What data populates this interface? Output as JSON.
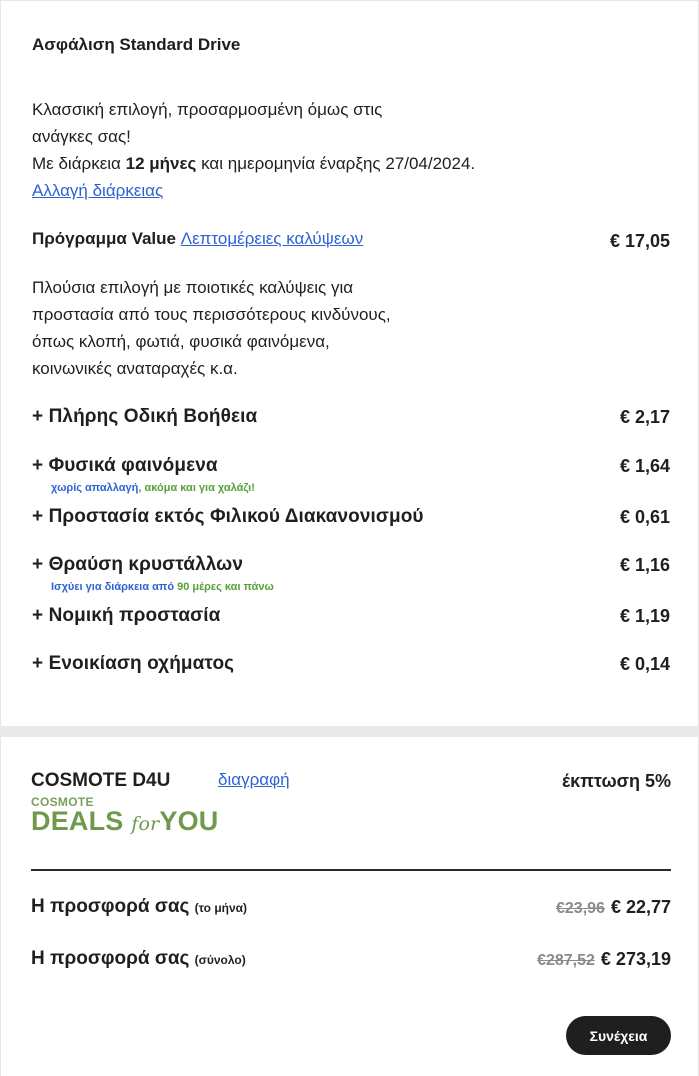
{
  "insurance": {
    "title": "Ασφάλιση Standard Drive",
    "intro_line1": "Κλασσική επιλογή, προσαρμοσμένη όμως στις",
    "intro_line2": "ανάγκες σας!",
    "duration_prefix": "Με διάρκεια ",
    "duration_value": "12 μήνες",
    "duration_suffix": " και ημερομηνία έναρξης 27/04/2024.",
    "change_duration_link": "Αλλαγή διάρκειας"
  },
  "program": {
    "name": "Πρόγραμμα Value",
    "details_link": "Λεπτομέρειες καλύψεων",
    "price": "€ 17,05",
    "description_lines": [
      "Πλούσια επιλογή με ποιοτικές καλύψεις για",
      "προστασία από τους περισσότερους κινδύνους,",
      "όπως κλοπή, φωτιά, φυσικά φαινόμενα,",
      "κοινωνικές αναταραχές κ.α."
    ]
  },
  "addons": [
    {
      "label": "+ Πλήρης Οδική Βοήθεια",
      "price": "€ 2,17"
    },
    {
      "label": "+ Φυσικά φαινόμενα",
      "price": "€ 1,64",
      "note_blue": "χωρίς απαλλαγή",
      "note_green": ", ακόμα και για χαλάζι!"
    },
    {
      "label": "+ Προστασία εκτός Φιλικού Διακανονισμού",
      "price": "€ 0,61"
    },
    {
      "label": "+ Θραύση κρυστάλλων",
      "price": "€ 1,16",
      "note_blue": "Ισχύει για διάρκεια από ",
      "note_green": "90 μέρες και πάνω"
    },
    {
      "label": "+ Νομική προστασία",
      "price": "€ 1,19"
    },
    {
      "label": "+ Ενοικίαση οχήματος",
      "price": "€ 0,14"
    }
  ],
  "discount": {
    "name": "COSMOTE D4U",
    "delete_link": "διαγραφή",
    "discount_text": "έκπτωση 5%",
    "logo_top": "COSMOTE",
    "logo_deals": "DEALS",
    "logo_for": "for",
    "logo_you": "YOU"
  },
  "offers": [
    {
      "label": "Η προσφορά σας",
      "qualifier": "(το μήνα)",
      "old_price": "€23,96",
      "new_price": "€ 22,77"
    },
    {
      "label": "Η προσφορά σας",
      "qualifier": "(σύνολο)",
      "old_price": "€287,52",
      "new_price": "€ 273,19"
    }
  ],
  "continue_button": "Συνέχεια",
  "colors": {
    "link": "#2f62d6",
    "note_green": "#57a03a",
    "logo_green": "#6f9a4e",
    "button_bg": "#1f1f1f"
  }
}
